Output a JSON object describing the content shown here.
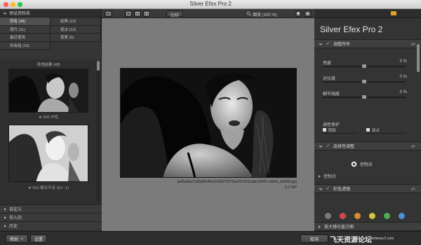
{
  "window": {
    "title": "Silver Efex Pro 2"
  },
  "left_panel": {
    "header": "预设资料库",
    "categories": [
      {
        "label": "所有 (48)",
        "active": true
      },
      {
        "label": "经典 (13)",
        "active": false
      },
      {
        "label": "现代 (11)",
        "active": false
      },
      {
        "label": "复古 (12)",
        "active": false
      },
      {
        "label": "最近使用",
        "active": false
      },
      {
        "label": "喜爱 (0)",
        "active": false
      },
      {
        "label": "所有组 (10)",
        "active": false
      }
    ],
    "results_title": "寻找结果 (48)",
    "thumbs": [
      {
        "caption": "★ 000 中性"
      },
      {
        "caption": "★ 001 曝光不足 (EV -1)"
      }
    ],
    "sections": [
      {
        "label": "自定义"
      },
      {
        "label": "导入的"
      },
      {
        "label": "历史"
      }
    ]
  },
  "toolbar": {
    "compare_label": "比较",
    "zoom_label": "缩放 (100 %)"
  },
  "image": {
    "filename": "aef5afba72d6d9e4fce2e9027874aef3741b1abc26ff3-rzEtm_fw658.jpg",
    "size": "0.3 MP"
  },
  "right_panel": {
    "product_name": "Silver Efex Pro",
    "product_version": "2",
    "adjust_all_label": "调整所有",
    "sliders": [
      {
        "label": "亮度",
        "value": "0 %",
        "level": 0.5
      },
      {
        "label": "对比度",
        "value": "0 %",
        "level": 0.5
      },
      {
        "label": "细节强度",
        "value": "0 %",
        "level": 0.5
      }
    ],
    "tone_protection": {
      "label": "调性保护",
      "shadows_label": "阴影",
      "highlights_label": "亮点"
    },
    "selective_label": "选择性调整",
    "control_point_button": "控制点",
    "control_points_label": "控制点",
    "color_filter_label": "彩色滤镜",
    "color_filters": [
      "#7a7a7a",
      "#d04a4a",
      "#d98b2f",
      "#d8c43a",
      "#4caf50",
      "#4f8fd6"
    ],
    "loupe_label": "放大镜与直方图"
  },
  "bottom_bar": {
    "help_label": "帮助",
    "settings_label": "设置",
    "cancel_label": "取消",
    "ok_label": "确定"
  },
  "watermark": {
    "text": "飞天资源论坛",
    "url": "feitianwu7.com"
  }
}
